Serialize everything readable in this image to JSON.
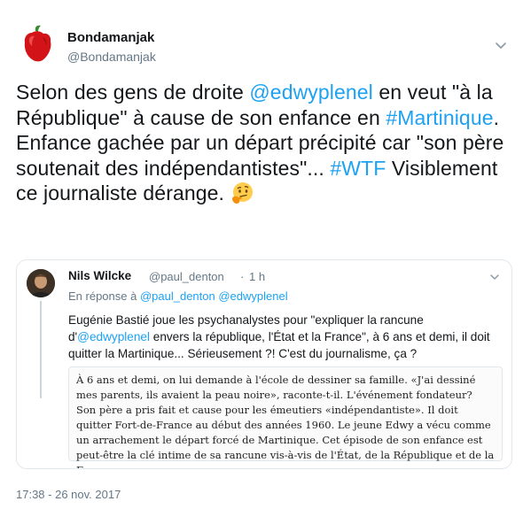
{
  "author": {
    "name": "Bondamanjak",
    "handle": "@Bondamanjak"
  },
  "tweet": {
    "parts": [
      {
        "text": "Selon des gens de droite ",
        "type": "text"
      },
      {
        "text": "@edwyplenel",
        "type": "mention"
      },
      {
        "text": " en veut \"à la République\" à cause de son enfance en ",
        "type": "text"
      },
      {
        "text": "#Martinique",
        "type": "hashtag"
      },
      {
        "text": ". Enfance gachée par un départ précipité car \"son père soutenait des indépendantistes\"... ",
        "type": "text"
      },
      {
        "text": "#WTF",
        "type": "hashtag"
      },
      {
        "text": " Visiblement ce journaliste dérange. ",
        "type": "text"
      }
    ],
    "emoji": "thinking-face-emoji"
  },
  "quoted": {
    "name": "Nils Wilcke",
    "handle": "@paul_denton",
    "separator": "·",
    "time": "1 h",
    "reply_prefix": "En réponse à ",
    "reply_mentions": [
      "@paul_denton",
      "@edwyplenel"
    ],
    "text_parts": [
      {
        "text": "Eugénie Bastié joue les psychanalystes pour \"expliquer la rancune d'",
        "type": "text"
      },
      {
        "text": "@edwyplenel",
        "type": "mention"
      },
      {
        "text": " envers la république, l'État et la France\", à 6 ans et demi, il doit quitter la Martinique... Sérieusement ?! C'est du journalisme, ça ?",
        "type": "text"
      }
    ],
    "excerpt": "À 6 ans et demi, on lui demande à l'école de dessiner sa famille. «J'ai dessiné mes parents, ils avaient la peau noire», raconte-t-il. L'événement fondateur? Son père a pris fait et cause pour les émeutiers «indépendantiste». Il doit quitter Fort-de-France au début des années 1960. Le jeune Edwy a vécu comme un arrachement le départ forcé de Martinique. Cet épisode de son enfance est peut-être la clé intime de sa rancune vis-à-vis de l'État, de la République et de la France."
  },
  "timestamp": "17:38 - 26 nov. 2017",
  "colors": {
    "link": "#1da1f2",
    "muted": "#657786",
    "text": "#14171a",
    "border": "#e1e8ed"
  }
}
